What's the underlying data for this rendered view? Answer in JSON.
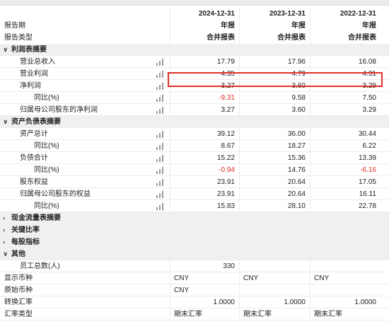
{
  "header": {
    "dates": [
      "2024-12-31",
      "2023-12-31",
      "2022-12-31"
    ]
  },
  "rows": [
    {
      "type": "hdr",
      "label": "报告期",
      "vals": [
        "年报",
        "年报",
        "年报"
      ]
    },
    {
      "type": "hdr",
      "label": "报告类型",
      "vals": [
        "合并报表",
        "合并报表",
        "合并报表"
      ]
    },
    {
      "type": "sec",
      "label": "利润表摘要",
      "caret": "∨"
    },
    {
      "type": "item",
      "indent": 1,
      "label": "营业总收入",
      "chart": true,
      "vals": [
        "17.79",
        "17.96",
        "16.08"
      ]
    },
    {
      "type": "item",
      "indent": 1,
      "label": "营业利润",
      "chart": true,
      "vals": [
        "4.35",
        "4.79",
        "4.31"
      ]
    },
    {
      "type": "item",
      "indent": 1,
      "label": "净利润",
      "chart": true,
      "vals": [
        "3.27",
        "3.60",
        "3.29"
      ]
    },
    {
      "type": "item",
      "indent": 2,
      "label": "同比(%)",
      "chart": true,
      "vals": [
        "-9.31",
        "9.58",
        "7.50"
      ]
    },
    {
      "type": "item",
      "indent": 1,
      "label": "归属母公司股东的净利润",
      "chart": true,
      "vals": [
        "3.27",
        "3.60",
        "3.29"
      ]
    },
    {
      "type": "sec",
      "label": "资产负债表摘要",
      "caret": "∨"
    },
    {
      "type": "item",
      "indent": 1,
      "label": "资产总计",
      "chart": true,
      "vals": [
        "39.12",
        "36.00",
        "30.44"
      ]
    },
    {
      "type": "item",
      "indent": 2,
      "label": "同比(%)",
      "chart": true,
      "vals": [
        "8.67",
        "18.27",
        "6.22"
      ]
    },
    {
      "type": "item",
      "indent": 1,
      "label": "负债合计",
      "chart": true,
      "vals": [
        "15.22",
        "15.36",
        "13.39"
      ]
    },
    {
      "type": "item",
      "indent": 2,
      "label": "同比(%)",
      "chart": true,
      "vals": [
        "-0.94",
        "14.76",
        "-6.16"
      ]
    },
    {
      "type": "item",
      "indent": 1,
      "label": "股东权益",
      "chart": true,
      "vals": [
        "23.91",
        "20.64",
        "17.05"
      ]
    },
    {
      "type": "item",
      "indent": 1,
      "label": "归属母公司股东的权益",
      "chart": true,
      "vals": [
        "23.91",
        "20.64",
        "16.11"
      ]
    },
    {
      "type": "item",
      "indent": 2,
      "label": "同比(%)",
      "chart": true,
      "vals": [
        "15.83",
        "28.10",
        "22.78"
      ]
    },
    {
      "type": "sec",
      "label": "现金流量表摘要",
      "caret": "›"
    },
    {
      "type": "sec",
      "label": "关键比率",
      "caret": "›"
    },
    {
      "type": "sec",
      "label": "每股指标",
      "caret": "›"
    },
    {
      "type": "sec",
      "label": "其他",
      "caret": "∨"
    },
    {
      "type": "item",
      "indent": 1,
      "label": "员工总数(人)",
      "chart": false,
      "vals": [
        "330",
        "",
        ""
      ]
    },
    {
      "type": "item",
      "indent": 0,
      "label": "显示币种",
      "chart": false,
      "align": "left",
      "vals": [
        "CNY",
        "CNY",
        "CNY"
      ]
    },
    {
      "type": "item",
      "indent": 0,
      "label": "原始币种",
      "chart": false,
      "align": "left",
      "vals": [
        "CNY",
        "",
        ""
      ]
    },
    {
      "type": "item",
      "indent": 0,
      "label": "转换汇率",
      "chart": false,
      "vals": [
        "1.0000",
        "1.0000",
        "1.0000"
      ]
    },
    {
      "type": "item",
      "indent": 0,
      "label": "汇率类型",
      "chart": false,
      "align": "left",
      "vals": [
        "期末汇率",
        "期末汇率",
        "期末汇率"
      ]
    }
  ],
  "colors": {
    "negative": "#e0302a",
    "highlight": "#e0302a",
    "section_bg": "#f0f0f0"
  },
  "icons": {
    "row_chart": "bar-chart-icon",
    "expanded": "chevron-down-icon",
    "collapsed": "chevron-right-icon"
  }
}
